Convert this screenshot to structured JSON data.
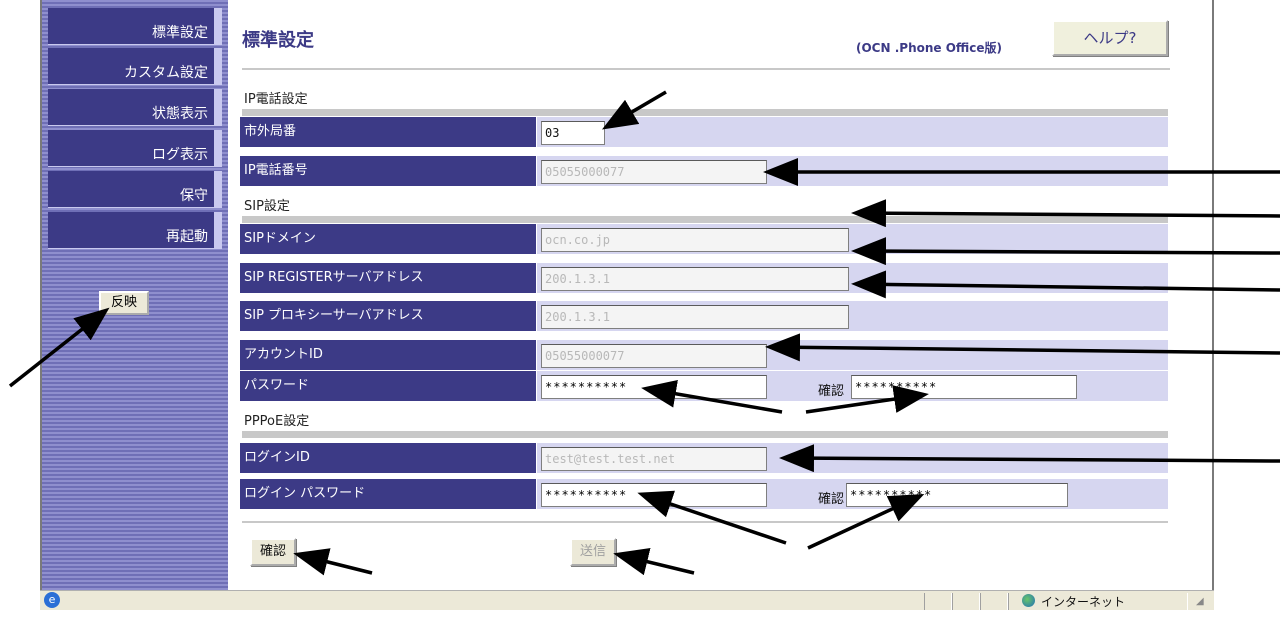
{
  "sidebar": {
    "items": [
      {
        "label": "標準設定"
      },
      {
        "label": "カスタム設定"
      },
      {
        "label": "状態表示"
      },
      {
        "label": "ログ表示"
      },
      {
        "label": "保守"
      },
      {
        "label": "再起動"
      }
    ],
    "apply_label": "反映"
  },
  "header": {
    "title": "標準設定",
    "edition": "(OCN .Phone Office版)",
    "help_label": "ヘルプ?"
  },
  "sections": {
    "ip": {
      "title": "IP電話設定",
      "area_code_label": "市外局番",
      "area_code_value": "03",
      "phone_label": "IP電話番号",
      "phone_value": "05055000077"
    },
    "sip": {
      "title": "SIP設定",
      "domain_label": "SIPドメイン",
      "domain_value": "ocn.co.jp",
      "register_label": "SIP REGISTERサーバアドレス",
      "register_value": "200.1.3.1",
      "proxy_label": "SIP プロキシーサーバアドレス",
      "proxy_value": "200.1.3.1",
      "account_label": "アカウントID",
      "account_value": "05055000077",
      "password_label": "パスワード",
      "password_value": "**********",
      "confirm_label": "確認",
      "confirm_value": "**********"
    },
    "pppoe": {
      "title": "PPPoE設定",
      "login_label": "ログインID",
      "login_value": "test@test.test.net",
      "login_pw_label": "ログイン パスワード",
      "login_pw_value": "**********",
      "confirm_label": "確認",
      "confirm_value": "**********"
    }
  },
  "footer": {
    "confirm_label": "確認",
    "send_label": "送信"
  },
  "statusbar": {
    "zone": "インターネット"
  },
  "colors": {
    "label_bg": "#3c3a86",
    "value_bg": "#d6d6f0",
    "sidebar_stripe": "#8f8fce"
  }
}
